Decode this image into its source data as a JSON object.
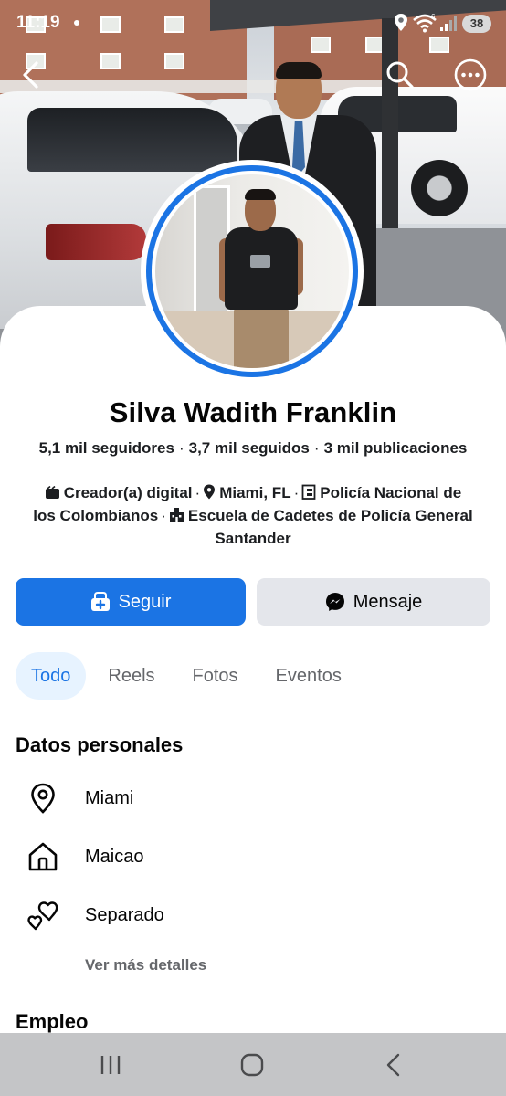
{
  "status_bar": {
    "time": "11:19",
    "battery": "38",
    "network": "6"
  },
  "profile": {
    "name": "Silva Wadith Franklin",
    "stats": {
      "followers": "5,1 mil seguidores",
      "following": "3,7 mil seguidos",
      "posts": "3 mil publicaciones"
    },
    "details": {
      "category": "Creador(a) digital",
      "location": "Miami, FL",
      "work_line1": "Policía Nacional de",
      "work_line2": "los Colombianos",
      "education_line1": "Escuela de Cadetes de Policía General",
      "education_line2": "Santander"
    }
  },
  "actions": {
    "follow_label": "Seguir",
    "message_label": "Mensaje"
  },
  "tabs": [
    {
      "label": "Todo",
      "active": true
    },
    {
      "label": "Reels",
      "active": false
    },
    {
      "label": "Fotos",
      "active": false
    },
    {
      "label": "Eventos",
      "active": false
    }
  ],
  "personal": {
    "title": "Datos personales",
    "items": [
      {
        "icon": "location-pin-icon",
        "text": "Miami"
      },
      {
        "icon": "home-icon",
        "text": "Maicao"
      },
      {
        "icon": "hearts-icon",
        "text": "Separado"
      }
    ],
    "more_label": "Ver más detalles"
  },
  "employment": {
    "title": "Empleo"
  },
  "icons": {
    "back": "back-arrow-icon",
    "search": "search-icon",
    "more": "more-icon",
    "follow": "add-friend-icon",
    "message": "messenger-icon",
    "nav_recents": "recents-icon",
    "nav_home": "home-button-icon",
    "nav_back": "nav-back-icon"
  },
  "colors": {
    "accent": "#1b74e4",
    "accent_bg": "#e7f3ff",
    "secondary_button": "#e4e6eb",
    "muted_text": "#65676b",
    "nav_bar": "#c4c5c7"
  }
}
